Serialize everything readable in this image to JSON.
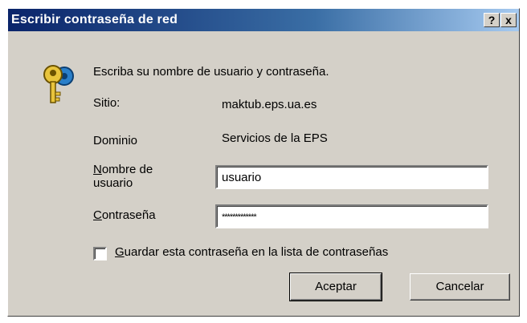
{
  "window": {
    "title": "Escribir contraseña de red",
    "help_button": "?",
    "close_button": "x"
  },
  "prompt": "Escriba su nombre de usuario y contraseña.",
  "site": {
    "label": "Sitio:",
    "value": "maktub.eps.ua.es"
  },
  "domain": {
    "label": "Dominio",
    "value": "Servicios de la EPS"
  },
  "username": {
    "label_first": "N",
    "label_rest": "ombre de",
    "label_line2": "usuario",
    "value": "usuario"
  },
  "password": {
    "label_first": "C",
    "label_rest": "ontraseña",
    "value": "*************"
  },
  "save_password": {
    "label_first": "G",
    "label_rest": "uardar esta contraseña en la lista de contraseñas",
    "checked": false
  },
  "buttons": {
    "ok": "Aceptar",
    "cancel": "Cancelar"
  },
  "colors": {
    "titlebar": "#0a246a",
    "dialog_bg": "#d4d0c8"
  }
}
